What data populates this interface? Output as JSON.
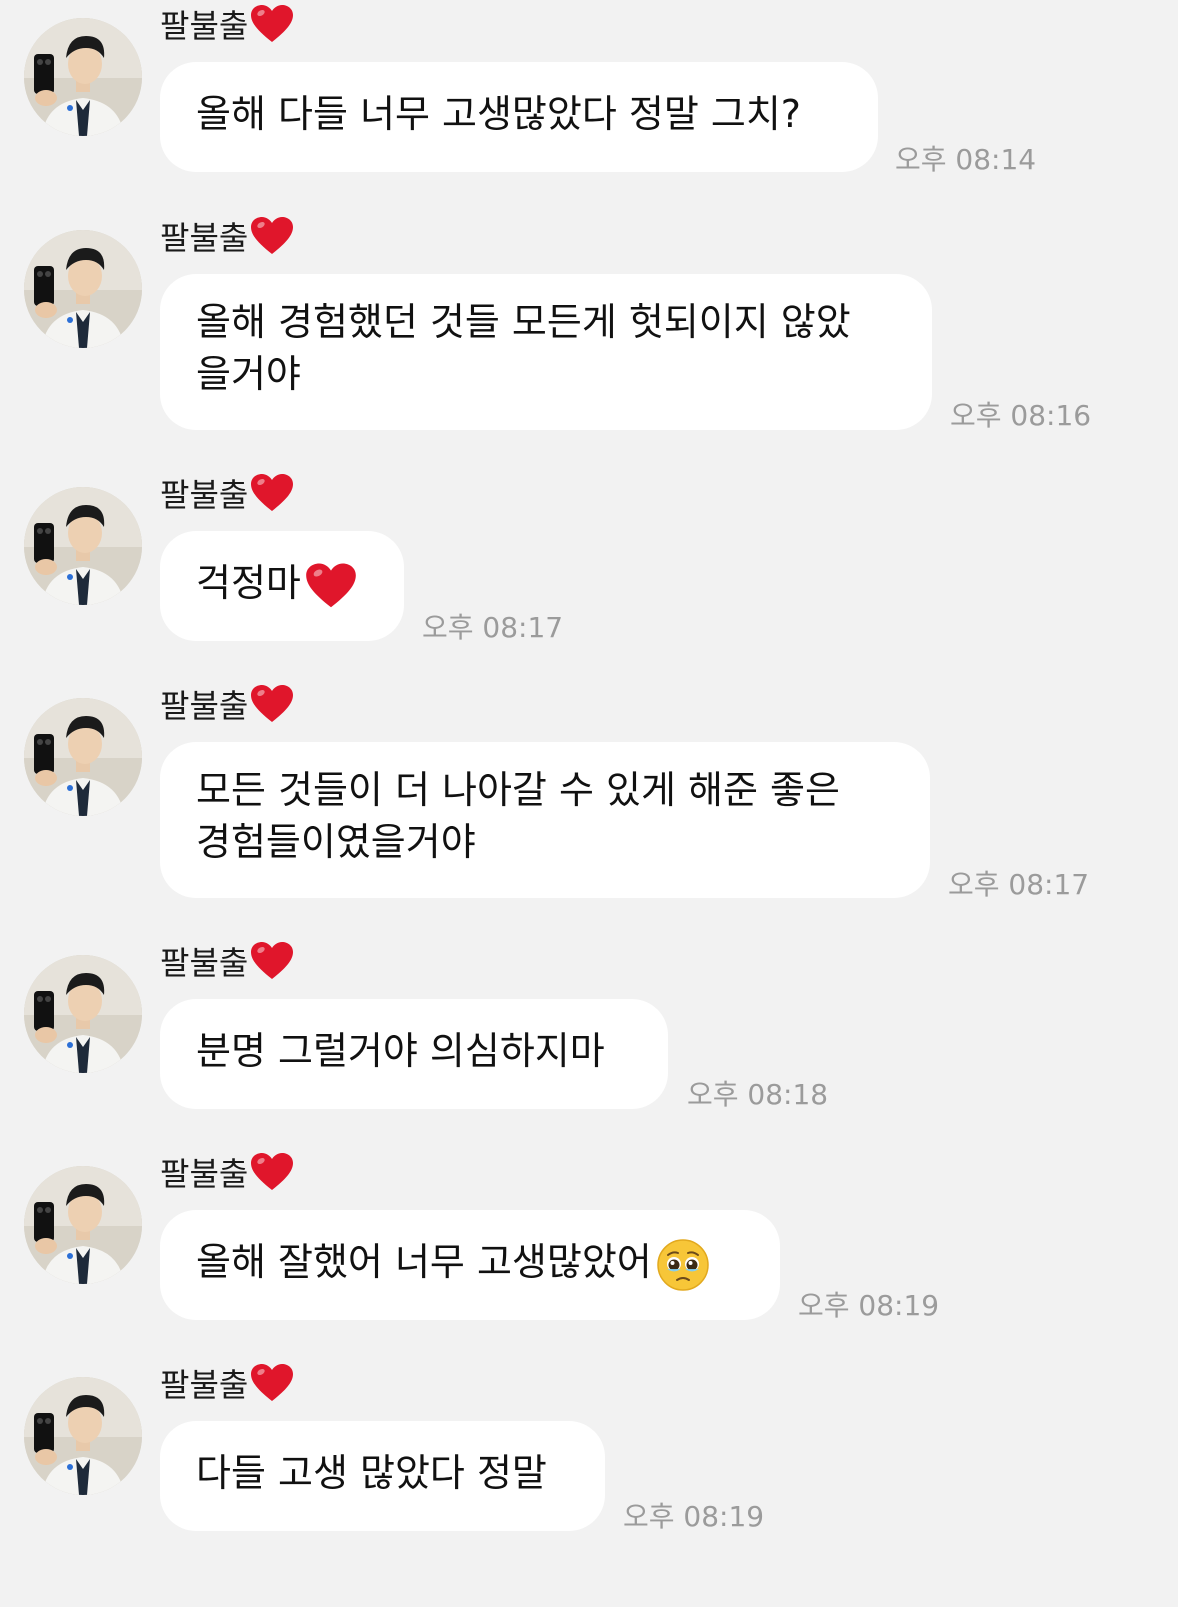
{
  "sender_name": "팔불출",
  "messages": [
    {
      "lines": [
        "올해 다들 너무 고생많았다 정말 그치?"
      ],
      "time": "오후 08:14"
    },
    {
      "lines": [
        "올해 경험했던 것들 모든게 헛되이지 않았",
        "을거야"
      ],
      "time": "오후 08:16"
    },
    {
      "lines": [
        "걱정마"
      ],
      "emoji": "heart-icon",
      "time": "오후 08:17"
    },
    {
      "lines": [
        "모든 것들이 더 나아갈 수 있게 해준 좋은",
        "경험들이였을거야"
      ],
      "time": "오후 08:17"
    },
    {
      "lines": [
        "분명 그럴거야 의심하지마"
      ],
      "time": "오후 08:18"
    },
    {
      "lines": [
        "올해 잘했어 너무 고생많았어"
      ],
      "emoji": "pleading-face-icon",
      "time": "오후 08:19"
    },
    {
      "lines": [
        "다들 고생 많았다 정말"
      ],
      "time": "오후 08:19"
    }
  ],
  "colors": {
    "background": "#f2f2f2",
    "bubble": "#ffffff",
    "timestamp": "#9b9b9b",
    "heart": "#e0162b"
  }
}
